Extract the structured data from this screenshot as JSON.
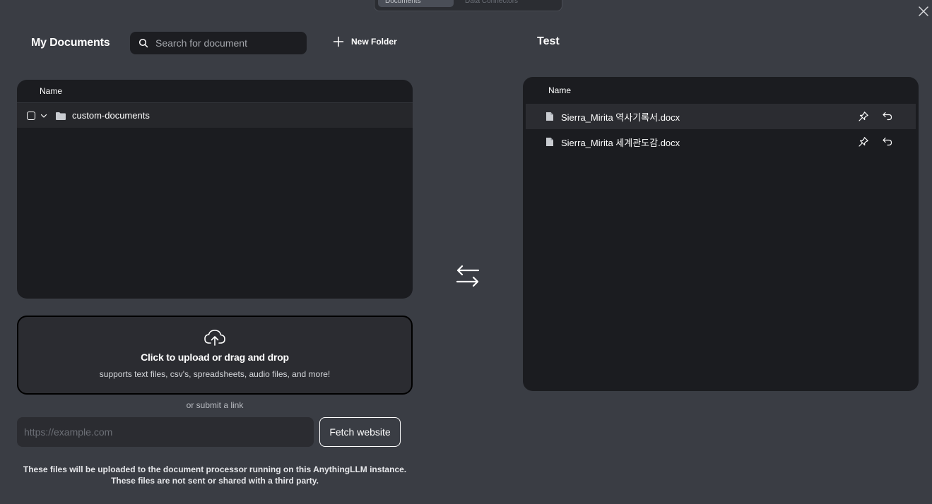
{
  "top_tabs": {
    "active": "Documents",
    "inactive": "Data Connectors"
  },
  "left": {
    "title": "My Documents",
    "search_placeholder": "Search for document",
    "new_folder_label": "New Folder",
    "column_name": "Name",
    "folders": [
      {
        "name": "custom-documents"
      }
    ]
  },
  "right": {
    "title": "Test",
    "column_name": "Name",
    "files": [
      {
        "name": "Sierra_Mirita 역사기록서.docx"
      },
      {
        "name": "Sierra_Mirita 세계관도감.docx"
      }
    ]
  },
  "upload": {
    "title": "Click to upload or drag and drop",
    "subtitle": "supports text files, csv's, spreadsheets, audio files, and more!",
    "or_link": "or submit a link",
    "url_placeholder": "https://example.com",
    "fetch_label": "Fetch website",
    "disclaimer_line1": "These files will be uploaded to the document processor running on this AnythingLLM instance.",
    "disclaimer_line2": "These files are not sent or shared with a third party."
  },
  "colors": {
    "background": "#3a3d44",
    "panel": "#1b1c20",
    "row_alt": "#2b2c31",
    "text": "#ffffff"
  },
  "icons": [
    "close-icon",
    "search-icon",
    "plus-icon",
    "chevron-down-icon",
    "folder-icon",
    "file-icon",
    "pin-icon",
    "undo-icon",
    "swap-arrows-icon",
    "cloud-upload-icon"
  ]
}
